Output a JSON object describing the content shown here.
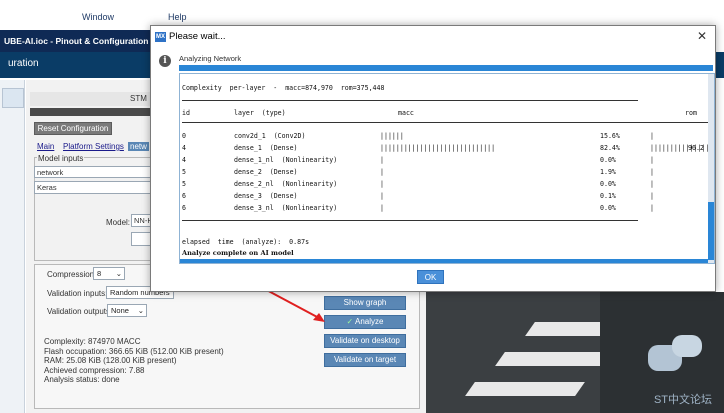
{
  "menubar": {
    "window_label": "Window",
    "help_label": "Help"
  },
  "app": {
    "title": "UBE-AI.ioc - Pinout & Configuration",
    "header_label": "uration",
    "stm_label": "STM"
  },
  "config": {
    "reset_button": "Reset Configuration",
    "tabs": [
      "Main",
      "Platform Settings",
      "netw"
    ],
    "model_inputs_legend": "Model inputs",
    "network_value": "network",
    "keras_value": "Keras",
    "model_label": "Model:",
    "model_value": "NN-H",
    "compression_label": "Compression:",
    "compression_value": "8",
    "validation_inputs_label": "Validation inputs:",
    "validation_inputs_value": "Random numbers",
    "validation_outputs_label": "Validation outputs:",
    "validation_outputs_value": "None",
    "buttons": {
      "show_graph": "Show graph",
      "analyze": "Analyze",
      "validate_desktop": "Validate on desktop",
      "validate_target": "Validate on target"
    },
    "stats": [
      "Complexity:  874970 MACC",
      "Flash occupation: 366.65 KiB (512.00 KiB present)",
      "RAM: 25.08 KiB (128.00 KiB present)",
      "Achieved compression: 7.88",
      "Analysis status: done"
    ]
  },
  "dialog": {
    "title": "Please wait...",
    "heading": "Analyzing Network",
    "close_glyph": "✕",
    "icon_letters": "MX",
    "info_glyph": "i",
    "ok_label": "OK",
    "console": {
      "complexity_line": "Complexity  per-layer  -  macc=874,970  rom=375,448",
      "col_id": "id",
      "col_layer": "layer  (type)",
      "col_macc": "macc",
      "col_rom": "rom",
      "rows": [
        {
          "id": "0",
          "layer": "conv2d_1  (Conv2D)",
          "macc_bar": "||||||",
          "macc_pct": "15.6%",
          "rom_bar": "|",
          "rom_pct": ""
        },
        {
          "id": "4",
          "layer": "dense_1  (Dense)",
          "macc_bar": "|||||||||||||||||||||||||||||",
          "macc_pct": "82.4%",
          "rom_bar": "||||||||||||||||||||||||||||||",
          "rom_pct": "96.2"
        },
        {
          "id": "4",
          "layer": "dense_1_nl  (Nonlinearity)",
          "macc_bar": "|",
          "macc_pct": "0.0%",
          "rom_bar": "|",
          "rom_pct": ""
        },
        {
          "id": "5",
          "layer": "dense_2  (Dense)",
          "macc_bar": "|",
          "macc_pct": "1.9%",
          "rom_bar": "|",
          "rom_pct": ""
        },
        {
          "id": "5",
          "layer": "dense_2_nl  (Nonlinearity)",
          "macc_bar": "|",
          "macc_pct": "0.0%",
          "rom_bar": "|",
          "rom_pct": ""
        },
        {
          "id": "6",
          "layer": "dense_3  (Dense)",
          "macc_bar": "|",
          "macc_pct": "0.1%",
          "rom_bar": "|",
          "rom_pct": ""
        },
        {
          "id": "6",
          "layer": "dense_3_nl  (Nonlinearity)",
          "macc_bar": "|",
          "macc_pct": "0.0%",
          "rom_bar": "|",
          "rom_pct": ""
        }
      ],
      "elapsed_line": "elapsed  time  (analyze):  0.87s",
      "complete_line": "Analyze complete on AI model"
    }
  },
  "watermark": "ST中文论坛",
  "colors": {
    "accent": "#2a86d6",
    "header": "#0a3c66",
    "button": "#5a87b5",
    "arrow": "#e02020"
  }
}
